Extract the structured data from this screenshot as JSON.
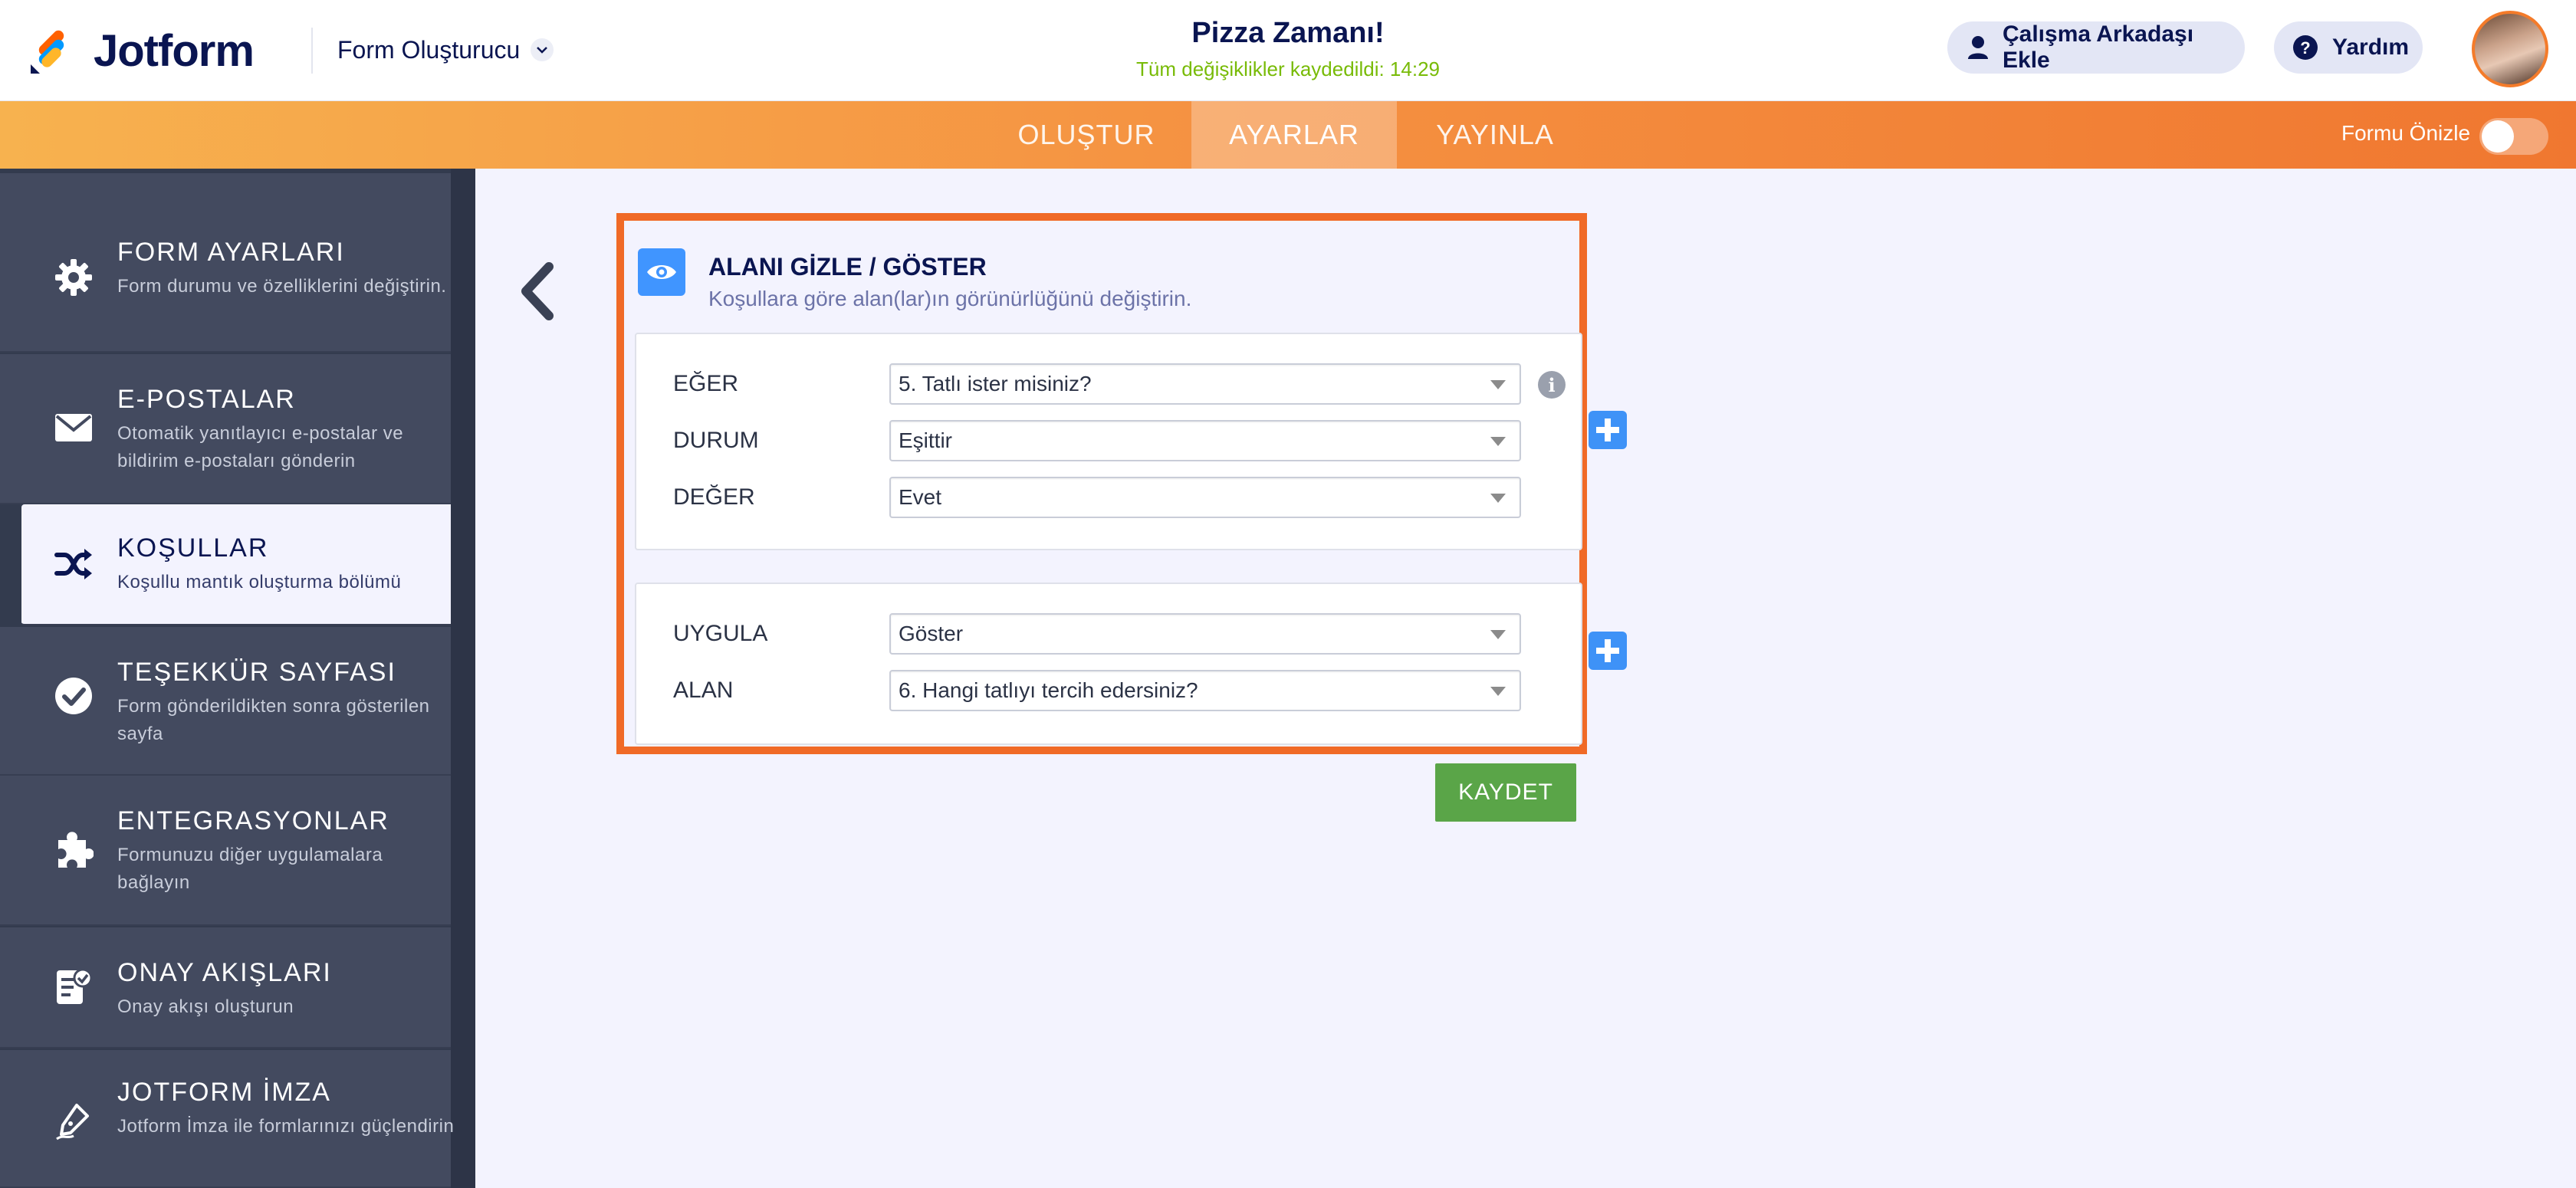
{
  "header": {
    "brand": "Jotform",
    "builder_menu": "Form Oluşturucu",
    "form_title": "Pizza Zamanı!",
    "saved_status": "Tüm değişiklikler kaydedildi: 14:29",
    "invite_button": "Çalışma Arkadaşı Ekle",
    "help_button": "Yardım"
  },
  "nav": {
    "tabs": [
      "OLUŞTUR",
      "AYARLAR",
      "YAYINLA"
    ],
    "active_tab": "AYARLAR",
    "preview_label": "Formu Önizle",
    "preview_on": false
  },
  "sidebar": {
    "items": [
      {
        "title": "FORM AYARLARI",
        "desc": "Form durumu ve özelliklerini değiştirin.",
        "icon": "gear-icon"
      },
      {
        "title": "E-POSTALAR",
        "desc": "Otomatik yanıtlayıcı e-postalar ve bildirim e-postaları gönderin",
        "icon": "envelope-icon"
      },
      {
        "title": "KOŞULLAR",
        "desc": "Koşullu mantık oluşturma bölümü",
        "icon": "shuffle-icon"
      },
      {
        "title": "TEŞEKKÜR SAYFASI",
        "desc": "Form gönderildikten sonra gösterilen sayfa",
        "icon": "check-circle-icon"
      },
      {
        "title": "ENTEGRASYONLAR",
        "desc": "Formunuzu diğer uygulamalara bağlayın",
        "icon": "puzzle-icon"
      },
      {
        "title": "ONAY AKIŞLARI",
        "desc": "Onay akışı oluşturun",
        "icon": "approval-icon"
      },
      {
        "title": "JOTFORM İMZA",
        "desc": "Jotform İmza ile formlarınızı güçlendirin",
        "icon": "pen-signature-icon"
      }
    ],
    "active_index": 2
  },
  "condition": {
    "title": "ALANI GİZLE / GÖSTER",
    "subtitle": "Koşullara göre alan(lar)ın görünürlüğünü değiştirin.",
    "if_block": {
      "if_label": "EĞER",
      "if_value": "5. Tatlı ister misiniz?",
      "state_label": "DURUM",
      "state_value": "Eşittir",
      "value_label": "DEĞER",
      "value_value": "Evet"
    },
    "do_block": {
      "do_label": "UYGULA",
      "do_value": "Göster",
      "field_label": "ALAN",
      "field_value": "6. Hangi tatlıyı tercih edersiniz?"
    },
    "save_button": "KAYDET"
  },
  "colors": {
    "accent_orange": "#f06a27",
    "sidebar_bg": "#434a5f",
    "add_blue": "#3e92f7",
    "save_green": "#5aa548",
    "saved_text_green": "#78bb07"
  }
}
